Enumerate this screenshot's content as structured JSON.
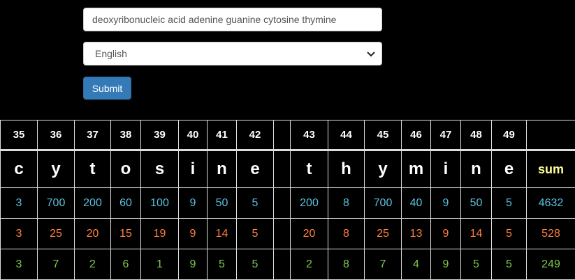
{
  "form": {
    "input_value": "deoxyribonucleic acid adenine guanine cytosine thymine",
    "language_selected": "English",
    "submit_label": "Submit"
  },
  "table": {
    "positions": [
      "35",
      "36",
      "37",
      "38",
      "39",
      "40",
      "41",
      "42",
      "",
      "43",
      "44",
      "45",
      "46",
      "47",
      "48",
      "49",
      ""
    ],
    "letters": [
      "c",
      "y",
      "t",
      "o",
      "s",
      "i",
      "n",
      "e",
      "",
      "t",
      "h",
      "y",
      "m",
      "i",
      "n",
      "e",
      "sum"
    ],
    "row1": [
      "3",
      "700",
      "200",
      "60",
      "100",
      "9",
      "50",
      "5",
      "",
      "200",
      "8",
      "700",
      "40",
      "9",
      "50",
      "5",
      "4632"
    ],
    "row2": [
      "3",
      "25",
      "20",
      "15",
      "19",
      "9",
      "14",
      "5",
      "",
      "20",
      "8",
      "25",
      "13",
      "9",
      "14",
      "5",
      "528"
    ],
    "row3": [
      "3",
      "7",
      "2",
      "6",
      "1",
      "9",
      "5",
      "5",
      "",
      "2",
      "8",
      "7",
      "4",
      "9",
      "5",
      "5",
      "249"
    ]
  },
  "colors": {
    "row1": "#5bc0de",
    "row2": "#ff7f3f",
    "row3": "#7ec850",
    "sum_label": "#ffff99",
    "submit_bg": "#337ab7"
  }
}
